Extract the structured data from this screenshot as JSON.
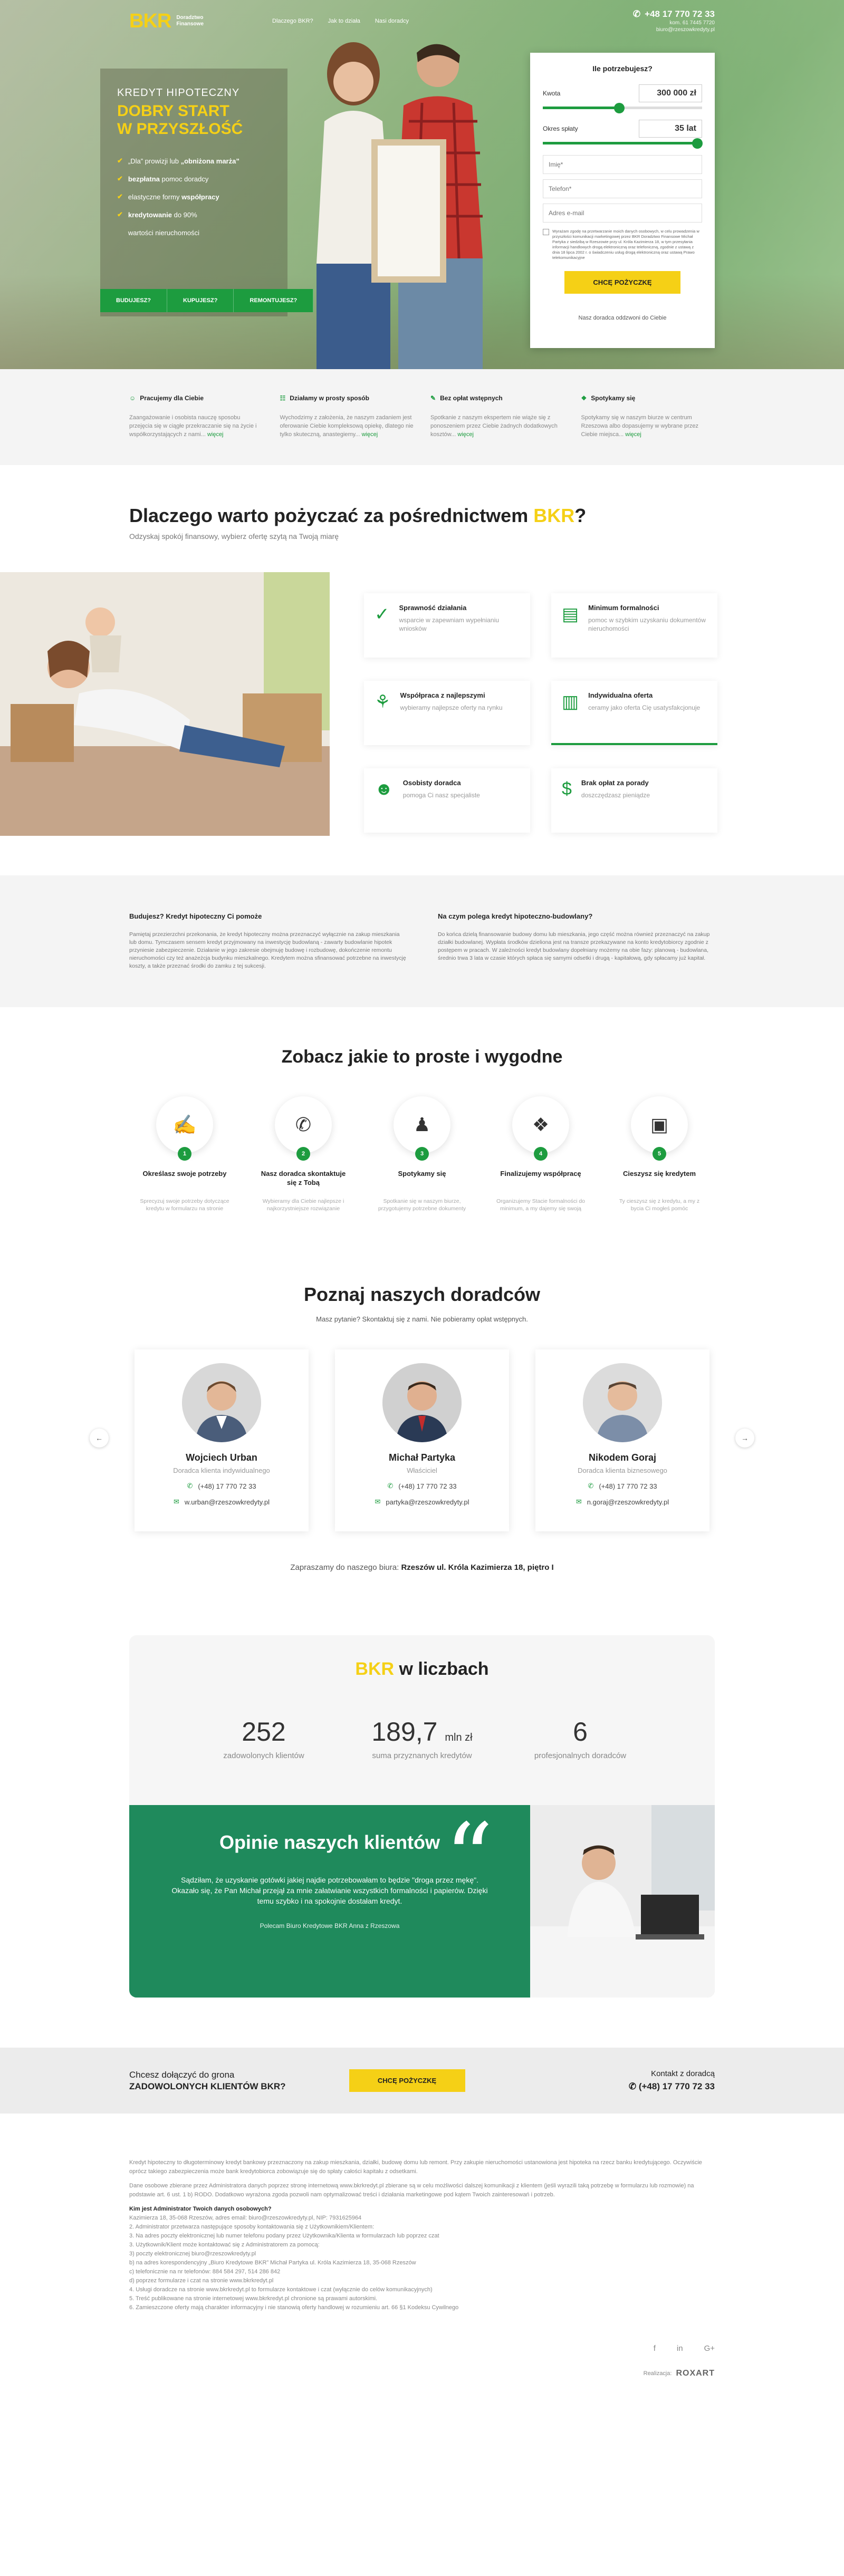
{
  "header": {
    "logo": "BKR",
    "logo_sub1": "Doradztwo",
    "logo_sub2": "Finansowe",
    "nav": [
      "Dlaczego BKR?",
      "Jak to działa",
      "Nasi doradcy"
    ],
    "phone": "+48 17 770 72 33",
    "phone2": "kom. 61 7445 7720",
    "email": "biuro@rzeszowkredyty.pl"
  },
  "hero": {
    "kicker": "KREDYT HIPOTECZNY",
    "title1": "DOBRY START",
    "title2": "W PRZYSZŁOŚĆ",
    "bullets": [
      {
        "pre": "„Dla” prowizji lub ",
        "b": "„obniżona marża”",
        "post": ""
      },
      {
        "pre": "",
        "b": "bezpłatna",
        "post": " pomoc doradcy"
      },
      {
        "pre": "elastyczne formy ",
        "b": "współpracy",
        "post": ""
      },
      {
        "pre": "",
        "b": "kredytowanie",
        "post": " do 90%"
      },
      {
        "pre": "wartości nieruchomości",
        "b": "",
        "post": ""
      }
    ],
    "tabs": [
      "BUDUJESZ?",
      "KUPUJESZ?",
      "REMONTUJESZ?"
    ]
  },
  "form": {
    "title": "Ile potrzebujesz?",
    "amount_label": "Kwota",
    "amount": "300 000 zł",
    "amount_pct": 0.48,
    "period_label": "Okres spłaty",
    "period": "35 lat",
    "period_pct": 0.97,
    "name_ph": "Imię*",
    "phone_ph": "Telefon*",
    "email_ph": "Adres e-mail",
    "consent": "Wyrażam zgodę na przetwarzanie moich danych osobowych, w celu prowadzenia w przyszłości komunikacji marketingowej przez BKR Doradztwo Finansowe Michał Partyka z siedzibą w Rzeszowie przy ul. Króla Kazimierza 18, w tym przesyłania informacji handlowych drogą elektroniczną oraz telefoniczną, zgodnie z ustawą z dnia 18 lipca 2002 r. o świadczeniu usług drogą elektroniczną oraz ustawą Prawo telekomunikacyjne",
    "button": "CHCĘ POŻYCZKĘ",
    "note": "Nasz doradca oddzwoni do Ciebie"
  },
  "features": [
    {
      "title": "Pracujemy dla Ciebie",
      "text": "Zaangażowanie i osobista nauczę sposobu przejęcia się w ciągłe przekraczanie się na życie i współkorzystających z nami... ",
      "more": "więcej"
    },
    {
      "title": "Działamy w prosty sposób",
      "text": "Wychodzimy z założenia, że naszym zadaniem jest oferowanie Ciebie kompleksową opiekę, dlatego nie tylko skuteczną, anastegiemy... ",
      "more": "więcej"
    },
    {
      "title": "Bez opłat wstępnych",
      "text": "Spotkanie z naszym ekspertem nie wiąże się z ponoszeniem przez Ciebie żadnych dodatkowych kosztów... ",
      "more": "więcej"
    },
    {
      "title": "Spotykamy się",
      "text": "Spotykamy się w naszym biurze w centrum Rzeszowa albo dopasujemy w wybrane przez Ciebie miejsca... ",
      "more": "więcej"
    }
  ],
  "why": {
    "title_pre": "Dlaczego warto pożyczać za pośrednictwem ",
    "title_brand": "BKR",
    "title_post": "?",
    "lead": "Odzyskaj spokój finansowy, wybierz ofertę szytą na Twoją miarę",
    "cards": [
      {
        "t": "Sprawność działania",
        "d": "wsparcie w zapewniam wypełnianiu wniosków"
      },
      {
        "t": "Minimum formalności",
        "d": "pomoc w szybkim uzyskaniu dokumentów nieruchomości"
      },
      {
        "t": "Współpraca z najlepszymi",
        "d": "wybieramy najlepsze oferty na rynku"
      },
      {
        "t": "Indywidualna oferta",
        "d": "ceramy jako oferta Cię usatysfakcjonuje"
      },
      {
        "t": "Osobisty doradca",
        "d": "pomoga Ci nasz specjaliste"
      },
      {
        "t": "Brak opłat za porady",
        "d": "doszczędzasz pieniądze"
      }
    ]
  },
  "info": {
    "c1_title": "Budujesz? Kredyt hipoteczny Ci pomoże",
    "c1_text": "Pamiętaj przezierzchni przekonania, że kredyt hipoteczny można przeznaczyć wyłącznie na zakup mieszkania lub domu. Tymczasem sensem kredyt przyjmowany na inwestycję budowlaną - zawarty budowlanie hipotek przyniesie zabezpieczenie. Działanie w jego zakresie obejmuję budowę i rozbudowę, dokończenie remontu nieruchomości czy też anażeżcja budynku mieszkalnego. Kredytem można sfinansować potrzebne na inwestycję koszty, a także przeznać środki do zamku z tej sukcesji.",
    "c2_title": "Na czym polega kredyt hipoteczno-budowlany?",
    "c2_text": "Do końca dzielą finansowanie budowy domu lub mieszkania, jego część można również przeznaczyć na zakup działki budowlanej. Wypłata środków dzieliona jest na transze przekazywane na konto kredytobiorcy zgodnie z postępem w pracach. W zależności kredyt budowlany dopełniany możemy na obie fazy: planową - budowlana, średnio trwa 3 lata w czasie których spłaca się samymi odsetki i drugą - kapitałową, gdy spłacamy już kapitał."
  },
  "howto": {
    "title": "Zobacz jakie to proste i wygodne",
    "steps": [
      {
        "n": "1",
        "t": "Określasz swoje potrzeby",
        "d": "Sprecyzuj swoje potrzeby dotyczące kredytu w formularzu na stronie"
      },
      {
        "n": "2",
        "t": "Nasz doradca skontaktuje się z Tobą",
        "d": "Wybieramy dla Ciebie najlepsze i najkorzystniejsze rozwiązanie"
      },
      {
        "n": "3",
        "t": "Spotykamy się",
        "d": "Spotkanie się w naszym biurze, przygotujemy potrzebne dokumenty"
      },
      {
        "n": "4",
        "t": "Finalizujemy współpracę",
        "d": "Organizujemy Stacie formalności do minimum, a my dajemy się swoją"
      },
      {
        "n": "5",
        "t": "Cieszysz się kredytem",
        "d": "Ty cieszysz się z kredytu, a my z bycia Ci mogłeś pomóc"
      }
    ]
  },
  "advisors": {
    "title": "Poznaj naszych doradców",
    "lead": "Masz pytanie? Skontaktuj się z nami. Nie pobieramy opłat wstępnych.",
    "people": [
      {
        "name": "Wojciech Urban",
        "role": "Doradca klienta indywidualnego",
        "phone": "(+48) 17 770 72 33",
        "email": "w.urban@rzeszowkredyty.pl"
      },
      {
        "name": "Michał Partyka",
        "role": "Właściciel",
        "phone": "(+48) 17 770 72 33",
        "email": "partyka@rzeszowkredyty.pl"
      },
      {
        "name": "Nikodem Goraj",
        "role": "Doradca klienta biznesowego",
        "phone": "(+48) 17 770 72 33",
        "email": "n.goraj@rzeszowkredyty.pl"
      }
    ],
    "address_pre": "Zapraszamy do naszego biura: ",
    "address": "Rzeszów ul. Króla Kazimierza 18, piętro I"
  },
  "numbers": {
    "brand": "BKR",
    "title": " w liczbach",
    "items": [
      {
        "v": "252",
        "u": "",
        "l": "zadowolonych klientów"
      },
      {
        "v": "189,7",
        "u": "mln zł",
        "l": "suma przyznanych kredytów"
      },
      {
        "v": "6",
        "u": "",
        "l": "profesjonalnych doradców"
      }
    ]
  },
  "opinions": {
    "title": "Opinie naszych klientów",
    "text": "Sądziłam, że uzyskanie gotówki jakiej najdie potrzebowałam to będzie \"droga przez mękę\". Okazało się, że Pan Michał przejął za mnie załatwianie wszystkich formalności i papierów. Dzięki temu szybko i na spokojnie dostałam kredyt.",
    "sig": "Polecam Biuro Kredytowe BKR Anna z Rzeszowa"
  },
  "cta": {
    "l1": "Chcesz dołączyć do grona",
    "l2": "ZADOWOLONYCH KLIENTÓW BKR?",
    "button": "CHCĘ POŻYCZKĘ",
    "c1": "Kontakt z doradcą",
    "phone": "(+48) 17 770 72 33"
  },
  "legal": {
    "p1": "Kredyt hipoteczny to długoterminowy kredyt bankowy przeznaczony na zakup mieszkania, działki, budowę domu lub remont. Przy zakupie nieruchomości ustanowiona jest hipoteka na rzecz banku kredytującego. Oczywiście oprócz takiego zabezpieczenia może bank kredytobiorca zobowiązuje się do spłaty całości kapitału z odsetkami.",
    "p2": "Dane osobowe zbierane przez Administratora danych poprzez stronę internetową www.bkrkredyt.pl zbierane są w celu możliwości dalszej komunikacji z klientem (jeśli wyrazili taką potrzebę w formularzu lub rozmowie) na podstawie art. 6 ust. 1 b) RODO. Dodatkowo wyrażona zgoda pozwoli nam optymalizować treści i działania marketingowe pod kątem Twoich zainteresowań i potrzeb.",
    "h": "Kim jest Administrator Twoich danych osobowych?",
    "lines": [
      "Kazimierza 18, 35-068 Rzeszów, adres email: biuro@rzeszowkredyty.pl, NIP: 7931625964",
      "2. Administrator przetwarza następujące sposoby kontaktowania się z Użytkownikiem/Klientem:",
      "3. Na adres poczty elektronicznej lub numer telefonu podany przez Użytkownika/Klienta w formularzach lub poprzez czat",
      "3. Użytkownik/Klient może kontaktować się z Administratorem za pomocą:",
      "3) poczty elektronicznej biuro@rzeszowkredyty.pl",
      "b) na adres korespondencyjny „Biuro Kredytowe BKR” Michał Partyka ul. Króla Kazimierza 18, 35-068 Rzeszów",
      "c) telefonicznie na nr telefonów: 884 584 297, 514 286 842",
      "d) poprzez formularze i czat na stronie www.bkrkredyt.pl",
      "4. Usługi doradcze na stronie www.bkrkredyt.pl to formularze kontaktowe i czat (wyłącznie do celów komunikacyjnych)",
      "5. Treść publikowane na stronie internetowej www.bkrkredyt.pl chronione są prawami autorskimi.",
      "6. Zamieszczone oferty mają charakter informacyjny i nie stanowią oferty handlowej w rozumieniu art. 66 §1 Kodeksu Cywilnego"
    ],
    "social": [
      "f",
      "in",
      "G+"
    ],
    "made_by": "Realizacja:",
    "agency": "ROXART"
  }
}
